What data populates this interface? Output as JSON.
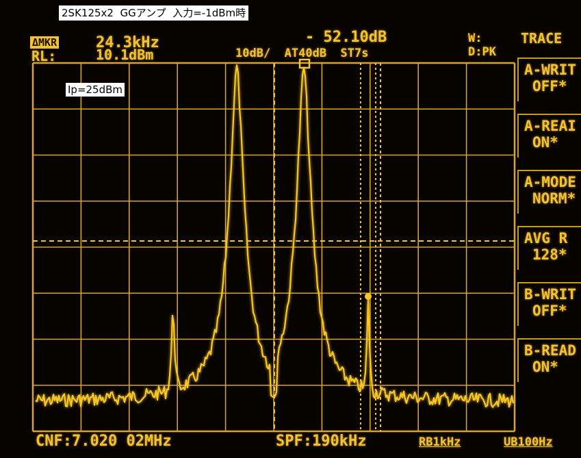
{
  "caption": "2SK125x2  GGアンプ  入力=-1dBm時",
  "annotation": "Ip=25dBm",
  "header": {
    "marker_tag": "ΔMKR",
    "marker_freq": "24.3kHz",
    "ref_label": "RL:",
    "ref_level": "10.1dBm",
    "marker_level": "- 52.10dB",
    "settings": "10dB/  AT40dB  ST7s",
    "window": "W:",
    "detector": "D:PK"
  },
  "menu": {
    "title": "TRACE",
    "items": [
      {
        "line1": "A-WRIT",
        "line2": "OFF*"
      },
      {
        "line1": "A-REAI",
        "line2": "ON*"
      },
      {
        "line1": "A-MODE",
        "line2": "NORM*"
      },
      {
        "line1": "AVG R",
        "line2": "128*"
      },
      {
        "line1": "B-WRIT",
        "line2": "OFF*"
      },
      {
        "line1": "B-READ",
        "line2": "ON*"
      }
    ]
  },
  "footer": {
    "center_freq": "CNF:7.020 02MHz",
    "span": "SPF:190kHz",
    "rbw": "RB1kHz",
    "vbw": "UB100Hz"
  },
  "colors": {
    "trace": "#f7c628",
    "grid": "#d9a522",
    "background": "#070400"
  }
}
